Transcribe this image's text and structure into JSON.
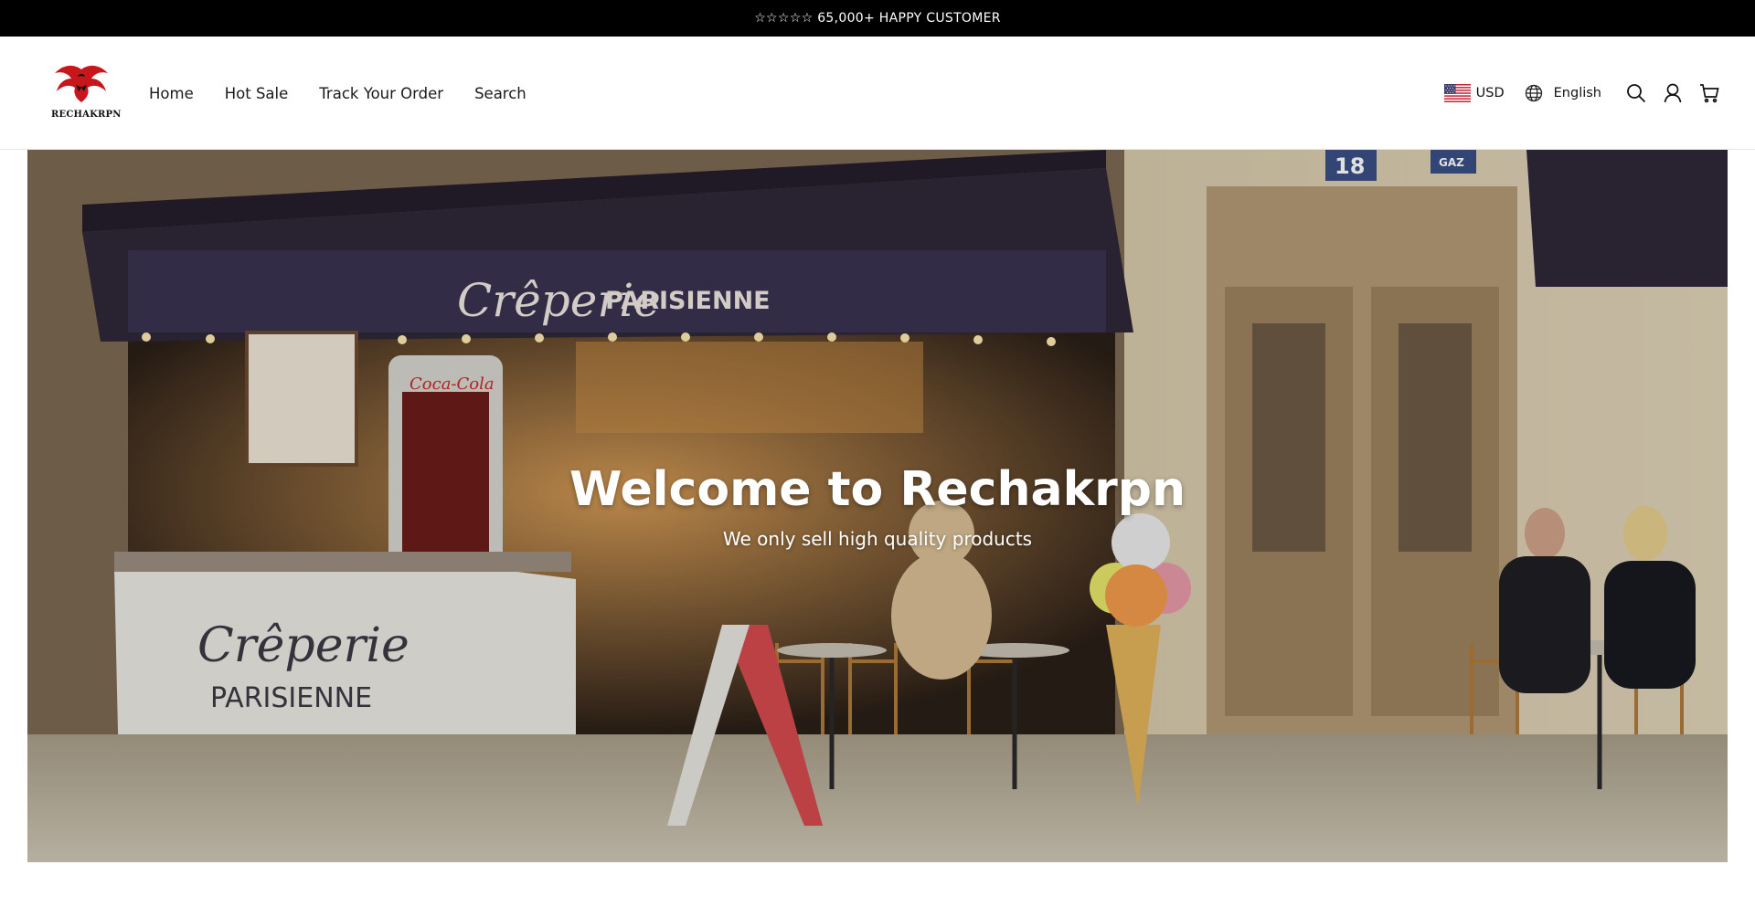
{
  "announcement": {
    "text": "☆☆☆☆☆ 65,000+ HAPPY CUSTOMER"
  },
  "brand": {
    "logo_text": "RECHAKRPN",
    "logo_icon": "dragon-logo-icon",
    "accent": "#c8161d"
  },
  "nav": {
    "items": [
      {
        "label": "Home"
      },
      {
        "label": "Hot Sale"
      },
      {
        "label": "Track Your Order"
      },
      {
        "label": "Search"
      }
    ]
  },
  "utilities": {
    "currency": {
      "label": "USD",
      "icon": "us-flag-icon"
    },
    "language": {
      "label": "English",
      "icon": "globe-icon"
    },
    "icons": [
      "search-icon",
      "account-icon",
      "cart-icon"
    ]
  },
  "hero": {
    "title": "Welcome to Rechakrpn",
    "subtitle": "We only sell high quality products",
    "awning_text_script": "Crêperie",
    "awning_text": "PARISIENNE",
    "cart_text_script": "Crêperie",
    "cart_text": "PARISIENNE",
    "fridge_text": "Coca-Cola",
    "house_number": "18",
    "sign_text": "GAZ"
  }
}
